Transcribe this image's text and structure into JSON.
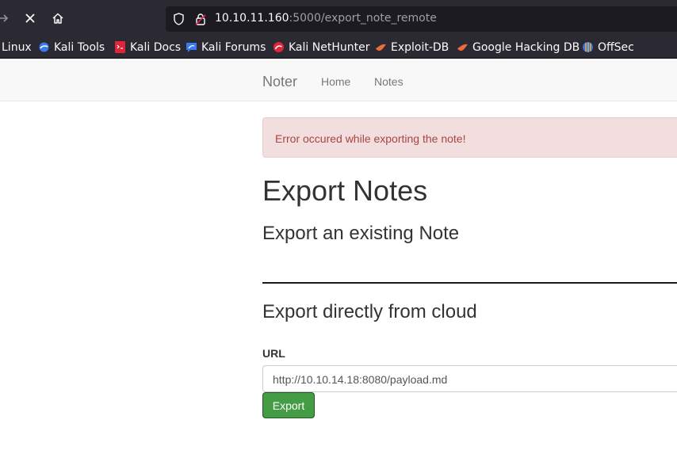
{
  "browser": {
    "url_host": "10.10.11.160",
    "url_rest": ":5000/export_note_remote",
    "icons": {
      "forward": "forward-arrow-icon",
      "stop": "stop-icon",
      "home": "home-icon",
      "shield": "shield-icon",
      "lock": "lock-icon"
    },
    "bookmarks": [
      {
        "label": "Linux",
        "icon": ""
      },
      {
        "label": "Kali Tools",
        "icon": "kali-tools-icon"
      },
      {
        "label": "Kali Docs",
        "icon": "kali-docs-icon"
      },
      {
        "label": "Kali Forums",
        "icon": "kali-forums-icon"
      },
      {
        "label": "Kali NetHunter",
        "icon": "kali-nethunter-icon"
      },
      {
        "label": "Exploit-DB",
        "icon": "exploit-db-icon"
      },
      {
        "label": "Google Hacking DB",
        "icon": "google-hacking-db-icon"
      },
      {
        "label": "OffSec",
        "icon": "offsec-icon"
      }
    ]
  },
  "navbar": {
    "brand": "Noter",
    "links": [
      {
        "label": "Home"
      },
      {
        "label": "Notes"
      }
    ]
  },
  "alert": {
    "message": "Error occured while exporting the note!"
  },
  "main": {
    "title": "Export Notes",
    "subtitle_existing": "Export an existing Note",
    "subtitle_cloud": "Export directly from cloud",
    "url_label": "URL",
    "url_value": "http://10.10.14.18:8080/payload.md",
    "export_button": "Export"
  },
  "colors": {
    "alert_bg": "#f2dede",
    "alert_text": "#a94442",
    "button_bg": "#449d44",
    "toolbar_bg": "#2b2a33"
  }
}
